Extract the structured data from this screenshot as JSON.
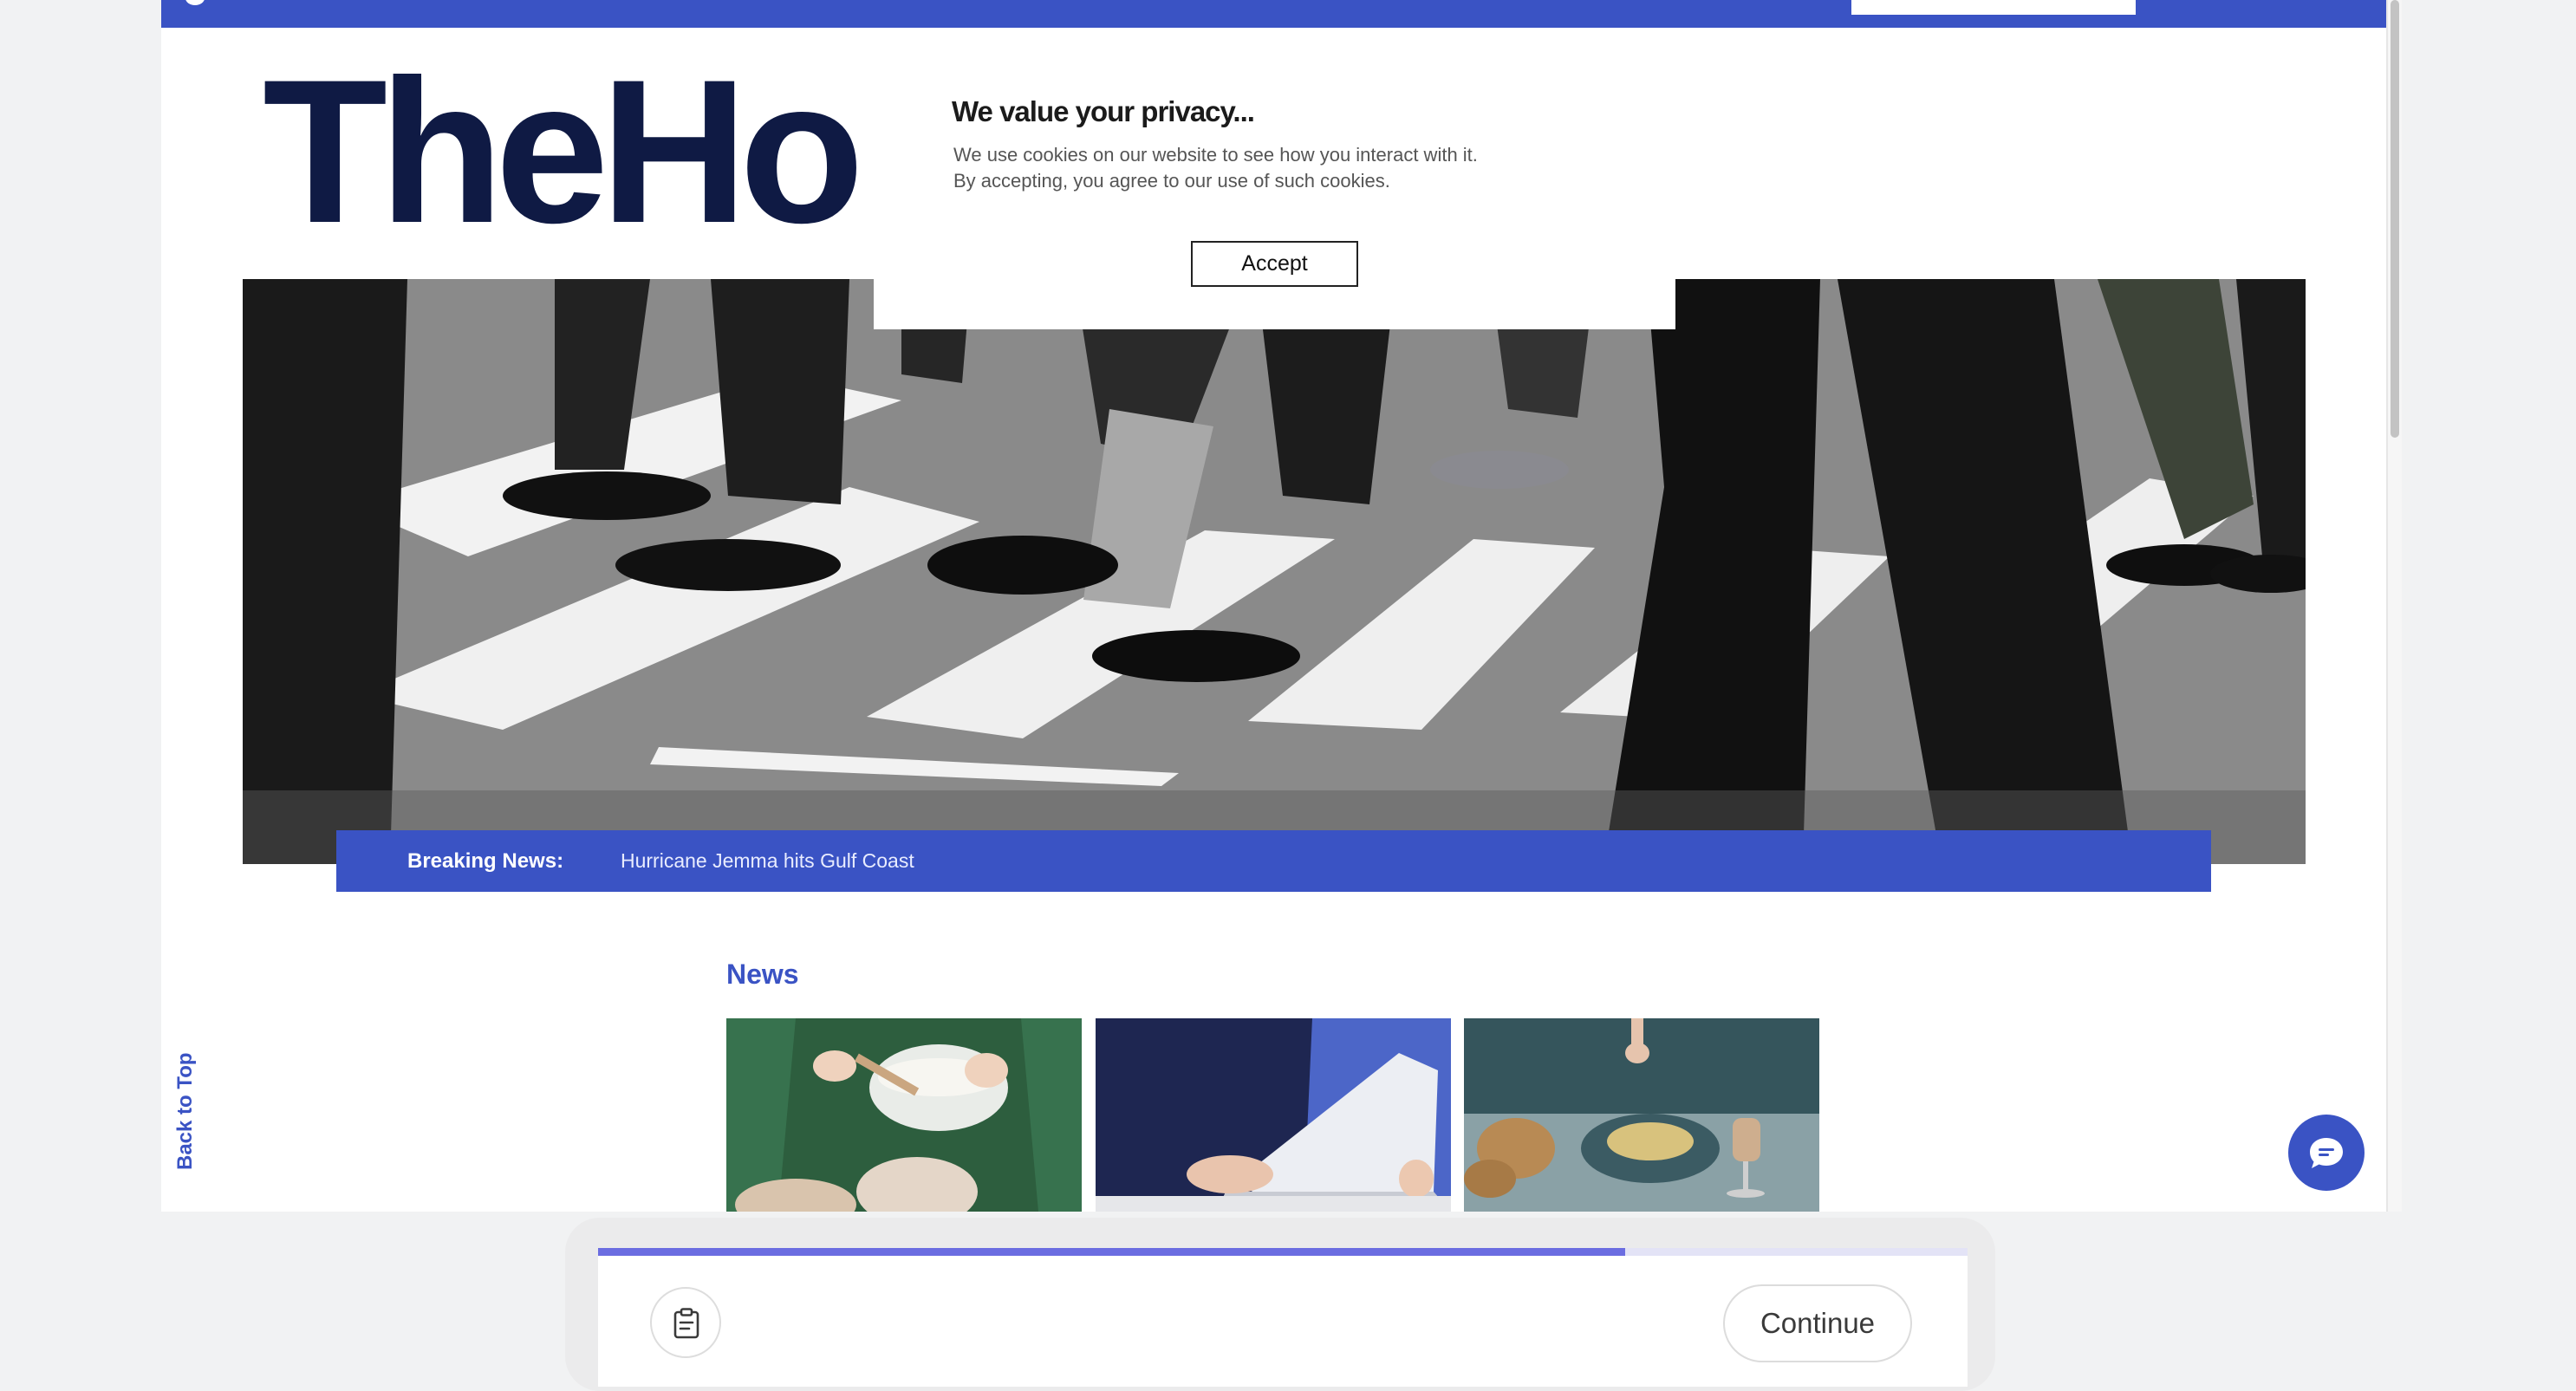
{
  "site": {
    "logo_text": "TheHo",
    "cookie_banner": {
      "title": "We value your privacy...",
      "line1": "We use cookies on our website to see how you interact with it.",
      "line2": "By accepting, you agree to our use of such cookies.",
      "accept_label": "Accept"
    },
    "breaking_news": {
      "label": "Breaking News:",
      "headline": "Hurricane Jemma hits Gulf Coast"
    },
    "news": {
      "heading": "News",
      "cards": [
        {
          "image": "baking-bowl-photo"
        },
        {
          "image": "laptop-person-photo"
        },
        {
          "image": "pasta-dinner-photo"
        }
      ]
    },
    "back_to_top_label": "Back to Top",
    "chat_icon": "chat-bubble-icon",
    "hero_image": "crosswalk-pedestrians-photo",
    "colors": {
      "brand_blue": "#3a53c4",
      "logo_navy": "#0f1a44"
    }
  },
  "task_panel": {
    "progress_fraction": 0.75,
    "clipboard_icon": "clipboard-icon",
    "continue_label": "Continue",
    "colors": {
      "progress": "#6b6de1"
    }
  }
}
